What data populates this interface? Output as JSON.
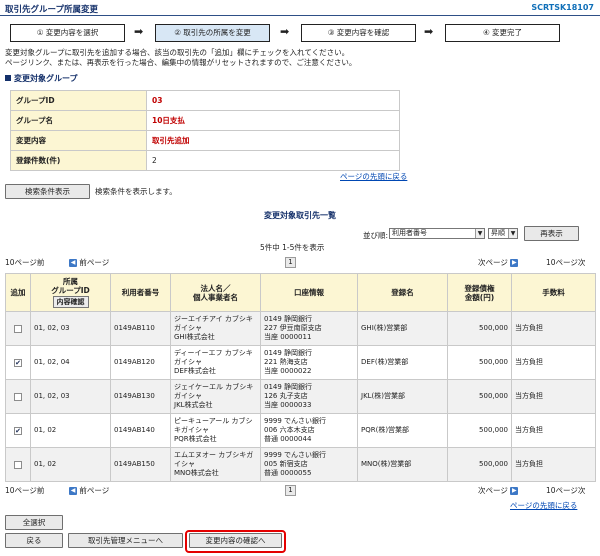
{
  "header": {
    "title": "取引先グループ所属変更",
    "screen_code": "SCRTSK18107"
  },
  "steps": [
    {
      "label": "① 変更内容を選択",
      "active": false
    },
    {
      "label": "② 取引先の所属を変更",
      "active": true
    },
    {
      "label": "③ 変更内容を確認",
      "active": false
    },
    {
      "label": "④ 変更完了",
      "active": false
    }
  ],
  "message": {
    "line1": "変更対象グループに取引先を追加する場合、該当の取引先の「追加」欄にチェックを入れてください。",
    "line2": "ページリンク、または、再表示を行った場合、編集中の情報がリセットされますので、ご注意ください。"
  },
  "group_section": {
    "title": "変更対象グループ",
    "rows": [
      {
        "label": "グループID",
        "value": "03"
      },
      {
        "label": "グループ名",
        "value": "10日支払"
      },
      {
        "label": "変更内容",
        "value": "取引先追加"
      },
      {
        "label": "登録件数(件)",
        "value": "2"
      }
    ]
  },
  "links": {
    "page_top": "ページの先頭に戻る"
  },
  "search": {
    "button": "検索条件表示",
    "desc": "検索条件を表示します。"
  },
  "list": {
    "title": "変更対象取引先一覧",
    "sort_label": "並び順:",
    "sort_value": "利用者番号",
    "order_value": "昇順",
    "redisplay": "再表示",
    "count_text": "5件中 1-5件を表示",
    "prev10": "10ページ前",
    "prev": "前ページ",
    "page": "1",
    "next": "次ページ",
    "next10": "10ページ次",
    "headers": {
      "add": "追加",
      "group_id_line1": "所属",
      "group_id_line2": "グループID",
      "confirm_btn": "内容確認",
      "user_no": "利用者番号",
      "name_line1": "法人名／",
      "name_line2": "個人事業者名",
      "account": "口座情報",
      "reg_name": "登録名",
      "amount_line1": "登録債権",
      "amount_line2": "金額(円)",
      "fee": "手数料"
    },
    "rows": [
      {
        "checked": false,
        "groups": "01, 02, 03",
        "user_no": "0149AB110",
        "kana": "ジーエイチアイ カブシキガイシャ",
        "corp": "GHI株式会社",
        "acc1": "0149 静岡銀行",
        "acc2": "227 伊豆南原支店",
        "acc3": "当座 0000011",
        "reg": "GHI(株)営業部",
        "amount": "500,000",
        "fee": "当方負担"
      },
      {
        "checked": true,
        "groups": "01, 02, 04",
        "user_no": "0149AB120",
        "kana": "ディーイーエフ カブシキガイシャ",
        "corp": "DEF株式会社",
        "acc1": "0149 静岡銀行",
        "acc2": "221 熱海支店",
        "acc3": "当座 0000022",
        "reg": "DEF(株)営業部",
        "amount": "500,000",
        "fee": "当方負担"
      },
      {
        "checked": false,
        "groups": "01, 02, 03",
        "user_no": "0149AB130",
        "kana": "ジェイケーエル カブシキガイシャ",
        "corp": "JKL株式会社",
        "acc1": "0149 静岡銀行",
        "acc2": "126 丸子支店",
        "acc3": "当座 0000033",
        "reg": "JKL(株)営業部",
        "amount": "500,000",
        "fee": "当方負担"
      },
      {
        "checked": true,
        "groups": "01, 02",
        "user_no": "0149AB140",
        "kana": "ピーキューアール カブシキガイシャ",
        "corp": "PQR株式会社",
        "acc1": "9999 でんさい銀行",
        "acc2": "006 六本木支店",
        "acc3": "普通 0000044",
        "reg": "PQR(株)営業部",
        "amount": "500,000",
        "fee": "当方負担"
      },
      {
        "checked": false,
        "groups": "01, 02",
        "user_no": "0149AB150",
        "kana": "エムエヌオー カブシキガイシャ",
        "corp": "MNO株式会社",
        "acc1": "9999 でんさい銀行",
        "acc2": "005 新宿支店",
        "acc3": "普通 0000055",
        "reg": "MNO(株)営業部",
        "amount": "500,000",
        "fee": "当方負担"
      }
    ]
  },
  "footer_buttons": {
    "select_all": "全選択",
    "back": "戻る",
    "to_menu": "取引先管理メニューへ",
    "confirm": "変更内容の確認へ"
  }
}
